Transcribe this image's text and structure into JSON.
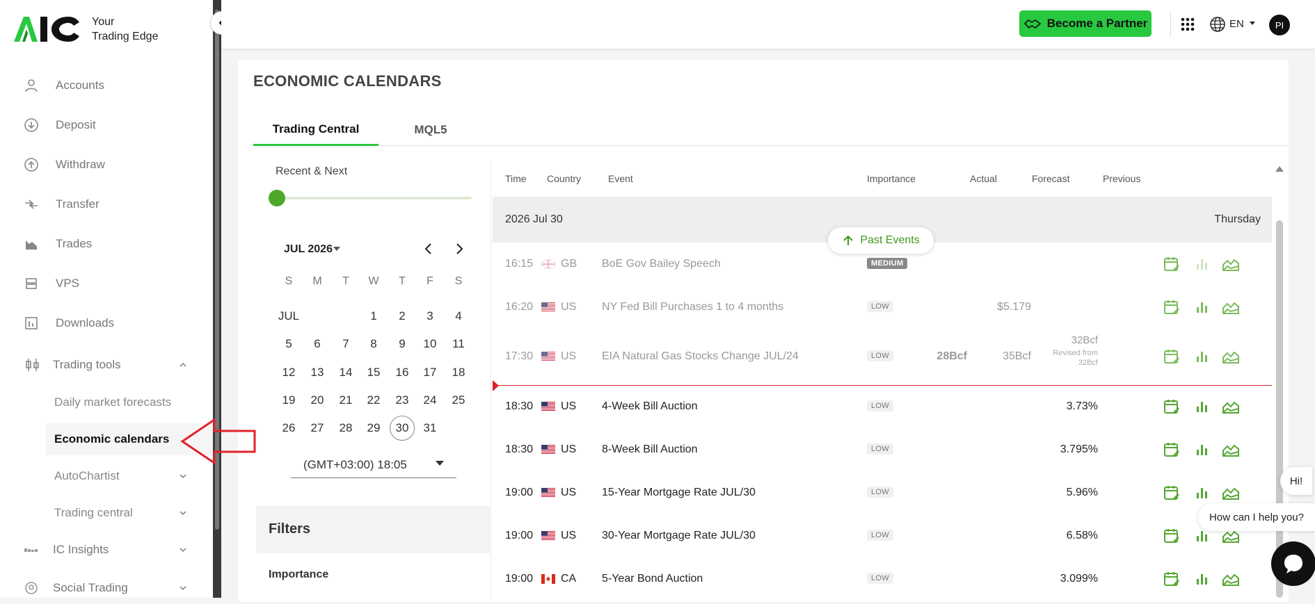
{
  "brand": {
    "tagline_line1": "Your",
    "tagline_line2": "Trading Edge"
  },
  "sidebar": {
    "items": [
      {
        "label": "Accounts",
        "icon": "person-icon"
      },
      {
        "label": "Deposit",
        "icon": "arrow-down-circle-icon"
      },
      {
        "label": "Withdraw",
        "icon": "arrow-up-circle-icon"
      },
      {
        "label": "Transfer",
        "icon": "transfer-icon"
      },
      {
        "label": "Trades",
        "icon": "area-chart-icon"
      },
      {
        "label": "VPS",
        "icon": "server-icon"
      },
      {
        "label": "Downloads",
        "icon": "download-icon"
      },
      {
        "label": "Trading tools",
        "icon": "candlestick-icon"
      }
    ],
    "trading_tools_sub": [
      {
        "label": "Daily market forecasts"
      },
      {
        "label": "Economic calendars",
        "active": true
      },
      {
        "label": "AutoChartist"
      },
      {
        "label": "Trading central"
      }
    ],
    "bottom_items": [
      {
        "label": "IC Insights",
        "icon": "insights-icon"
      },
      {
        "label": "Social Trading",
        "icon": "social-icon"
      }
    ]
  },
  "topbar": {
    "partner_label": "Become a Partner",
    "language": "EN",
    "avatar_initials": "PI"
  },
  "page": {
    "title": "ECONOMIC CALENDARS",
    "tabs": [
      {
        "label": "Trading Central",
        "active": true
      },
      {
        "label": "MQL5",
        "active": false
      }
    ]
  },
  "filters": {
    "range_label": "Recent & Next",
    "month_label": "JUL 2026",
    "weekdays": [
      "S",
      "M",
      "T",
      "W",
      "T",
      "F",
      "S"
    ],
    "month_short": "JUL",
    "selected_day": "30",
    "timezone": "(GMT+03:00) 18:05",
    "filters_title": "Filters",
    "importance_label": "Importance"
  },
  "table": {
    "headers": {
      "time": "Time",
      "country": "Country",
      "event": "Event",
      "importance": "Importance",
      "actual": "Actual",
      "forecast": "Forecast",
      "previous": "Previous"
    },
    "date": "2026 Jul 30",
    "weekday": "Thursday",
    "past_events_label": "Past Events",
    "rows": [
      {
        "time": "16:15",
        "country": "GB",
        "event": "BoE Gov Bailey Speech",
        "importance": "MEDIUM",
        "actual": "",
        "forecast": "",
        "previous": "",
        "revised": ""
      },
      {
        "time": "16:20",
        "country": "US",
        "event": "NY Fed Bill Purchases 1 to 4 months",
        "importance": "LOW",
        "actual": "",
        "forecast": "$5.179",
        "previous": "",
        "revised": ""
      },
      {
        "time": "17:30",
        "country": "US",
        "event": "EIA Natural Gas Stocks Change JUL/24",
        "importance": "LOW",
        "actual": "28Bcf",
        "forecast": "35Bcf",
        "previous": "32Bcf",
        "revised": "Revised from",
        "revised_value": "32Bcf"
      },
      {
        "time": "18:30",
        "country": "US",
        "event": "4-Week Bill Auction",
        "importance": "LOW",
        "actual": "",
        "forecast": "",
        "previous": "3.73%",
        "revised": ""
      },
      {
        "time": "18:30",
        "country": "US",
        "event": "8-Week Bill Auction",
        "importance": "LOW",
        "actual": "",
        "forecast": "",
        "previous": "3.795%",
        "revised": ""
      },
      {
        "time": "19:00",
        "country": "US",
        "event": "15-Year Mortgage Rate JUL/30",
        "importance": "LOW",
        "actual": "",
        "forecast": "",
        "previous": "5.96%",
        "revised": ""
      },
      {
        "time": "19:00",
        "country": "US",
        "event": "30-Year Mortgage Rate JUL/30",
        "importance": "LOW",
        "actual": "",
        "forecast": "",
        "previous": "6.58%",
        "revised": ""
      },
      {
        "time": "19:00",
        "country": "CA",
        "event": "5-Year Bond Auction",
        "importance": "LOW",
        "actual": "",
        "forecast": "",
        "previous": "3.099%",
        "revised": ""
      }
    ]
  },
  "chat": {
    "greeting": "Hi!",
    "prompt": "How can I help you?"
  },
  "colors": {
    "brand_green": "#28c840",
    "accent_green": "#4da82a",
    "now_line": "#d8262c",
    "annotation": "#e0232a"
  }
}
